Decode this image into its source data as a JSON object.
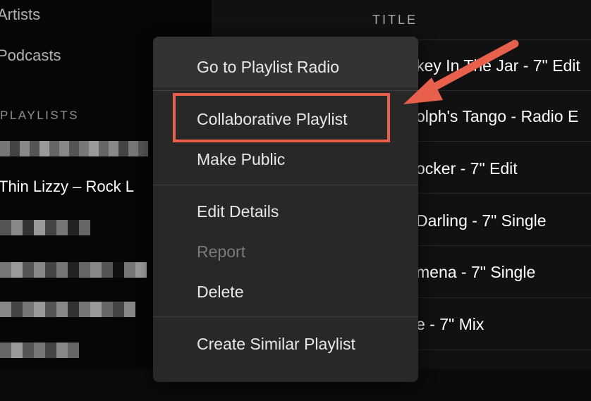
{
  "sidebar": {
    "nav": [
      {
        "label": "Artists"
      },
      {
        "label": "Podcasts"
      }
    ],
    "playlists_label": "PLAYLISTS",
    "playlists": [
      {
        "label": "Thin Lizzy – Rock L"
      }
    ]
  },
  "tracklist": {
    "title_header": "TITLE",
    "tracks": [
      "key In The Jar - 7\" Edit",
      "olph's Tango - Radio E",
      "ocker - 7\" Edit",
      "Darling - 7\" Single",
      "mena - 7\" Single",
      "e - 7\" Mix"
    ]
  },
  "context_menu": {
    "items": [
      {
        "label": "Go to Playlist Radio",
        "disabled": false
      },
      {
        "label": "Collaborative Playlist",
        "disabled": false
      },
      {
        "label": "Make Public",
        "disabled": false
      },
      {
        "label": "Edit Details",
        "disabled": false
      },
      {
        "label": "Report",
        "disabled": true
      },
      {
        "label": "Delete",
        "disabled": false
      },
      {
        "label": "Create Similar Playlist",
        "disabled": false
      }
    ]
  },
  "annotation": {
    "color": "#e8604c"
  }
}
